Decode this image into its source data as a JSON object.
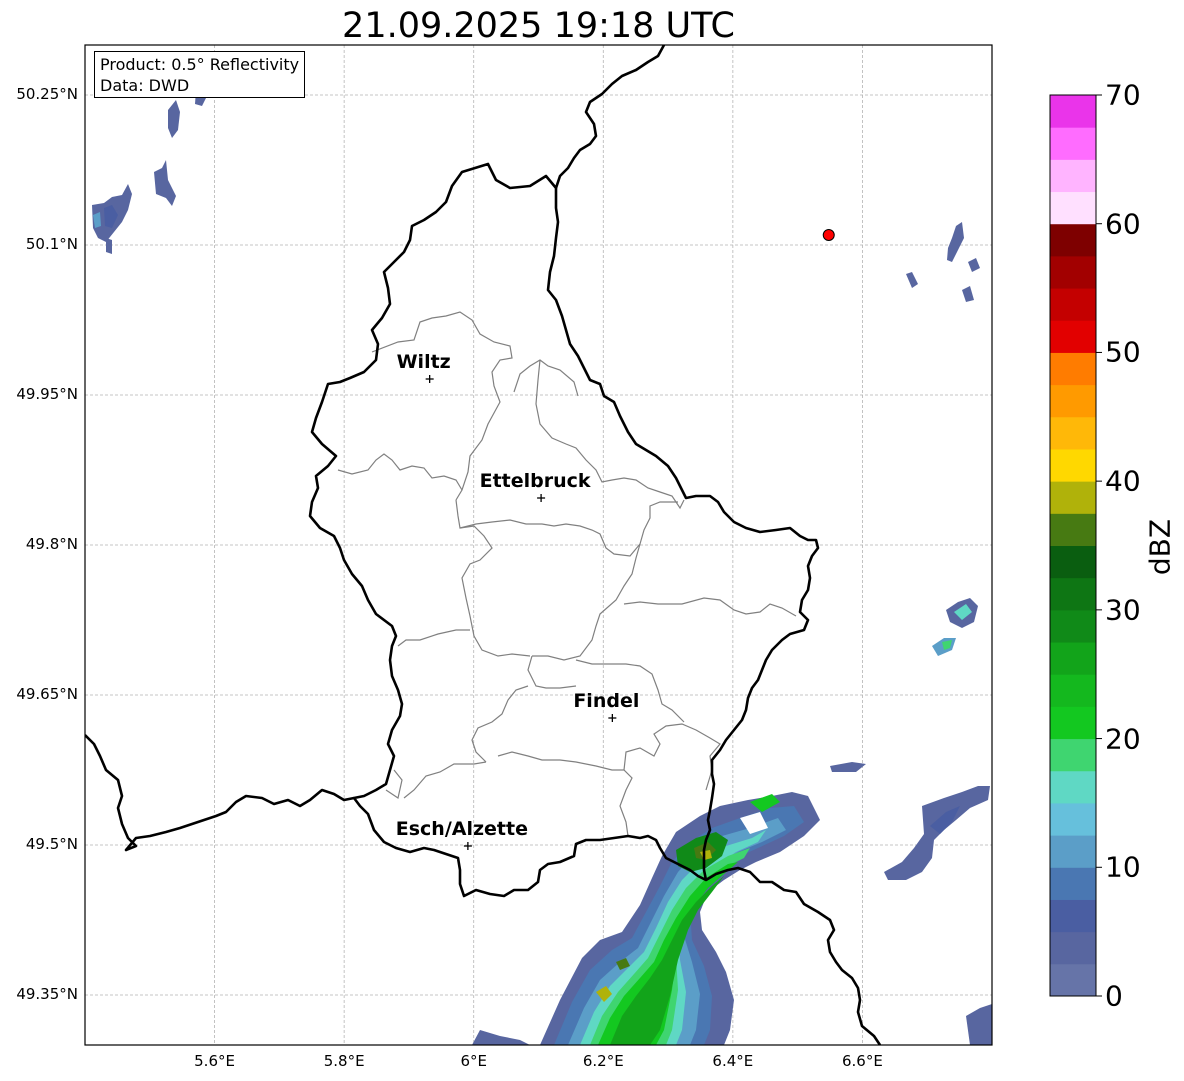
{
  "title": "21.09.2025 19:18 UTC",
  "info_box": {
    "product": "Product: 0.5° Reflectivity",
    "data": "Data: DWD"
  },
  "map": {
    "lon_range": [
      5.4,
      6.8
    ],
    "lat_range": [
      49.3,
      50.3
    ],
    "lat_ticks": [
      {
        "value": 50.25,
        "label": "50.25°N"
      },
      {
        "value": 50.1,
        "label": "50.1°N"
      },
      {
        "value": 49.95,
        "label": "49.95°N"
      },
      {
        "value": 49.8,
        "label": "49.8°N"
      },
      {
        "value": 49.65,
        "label": "49.65°N"
      },
      {
        "value": 49.5,
        "label": "49.5°N"
      },
      {
        "value": 49.35,
        "label": "49.35°N"
      }
    ],
    "lon_ticks": [
      {
        "value": 5.6,
        "label": "5.6°E"
      },
      {
        "value": 5.8,
        "label": "5.8°E"
      },
      {
        "value": 6.0,
        "label": "6°E"
      },
      {
        "value": 6.2,
        "label": "6.2°E"
      },
      {
        "value": 6.4,
        "label": "6.4°E"
      },
      {
        "value": 6.6,
        "label": "6.6°E"
      }
    ],
    "gridlines": true,
    "cities": [
      {
        "name": "Wiltz",
        "lon": 5.932,
        "lat": 49.966
      },
      {
        "name": "Ettelbruck",
        "lon": 6.104,
        "lat": 49.847
      },
      {
        "name": "Findel",
        "lon": 6.214,
        "lat": 49.627
      },
      {
        "name": "Esch/Alzette",
        "lon": 5.991,
        "lat": 49.499
      }
    ],
    "radar_site": {
      "lon": 6.548,
      "lat": 50.11,
      "color": "#ff0000"
    }
  },
  "colorbar": {
    "label": "dBZ",
    "min": 0,
    "max": 70,
    "ticks": [
      {
        "value": 0,
        "label": "0"
      },
      {
        "value": 10,
        "label": "10"
      },
      {
        "value": 20,
        "label": "20"
      },
      {
        "value": 30,
        "label": "30"
      },
      {
        "value": 40,
        "label": "40"
      },
      {
        "value": 50,
        "label": "50"
      },
      {
        "value": 60,
        "label": "60"
      },
      {
        "value": 70,
        "label": "70"
      }
    ],
    "colors": [
      "#6674a8",
      "#5866a0",
      "#4a5ea2",
      "#4a77b2",
      "#5b9ec8",
      "#66c0dc",
      "#5fd8c4",
      "#3fd570",
      "#13c820",
      "#14b81e",
      "#12a41a",
      "#108a18",
      "#0e7614",
      "#0a5e10",
      "#477a12",
      "#b0b20a",
      "#ffd800",
      "#ffb808",
      "#ff9a00",
      "#ff7c00",
      "#e20000",
      "#c40000",
      "#a20000",
      "#7e0000",
      "#ffe0ff",
      "#ffb4ff",
      "#ff6cff",
      "#ea34ea"
    ]
  }
}
